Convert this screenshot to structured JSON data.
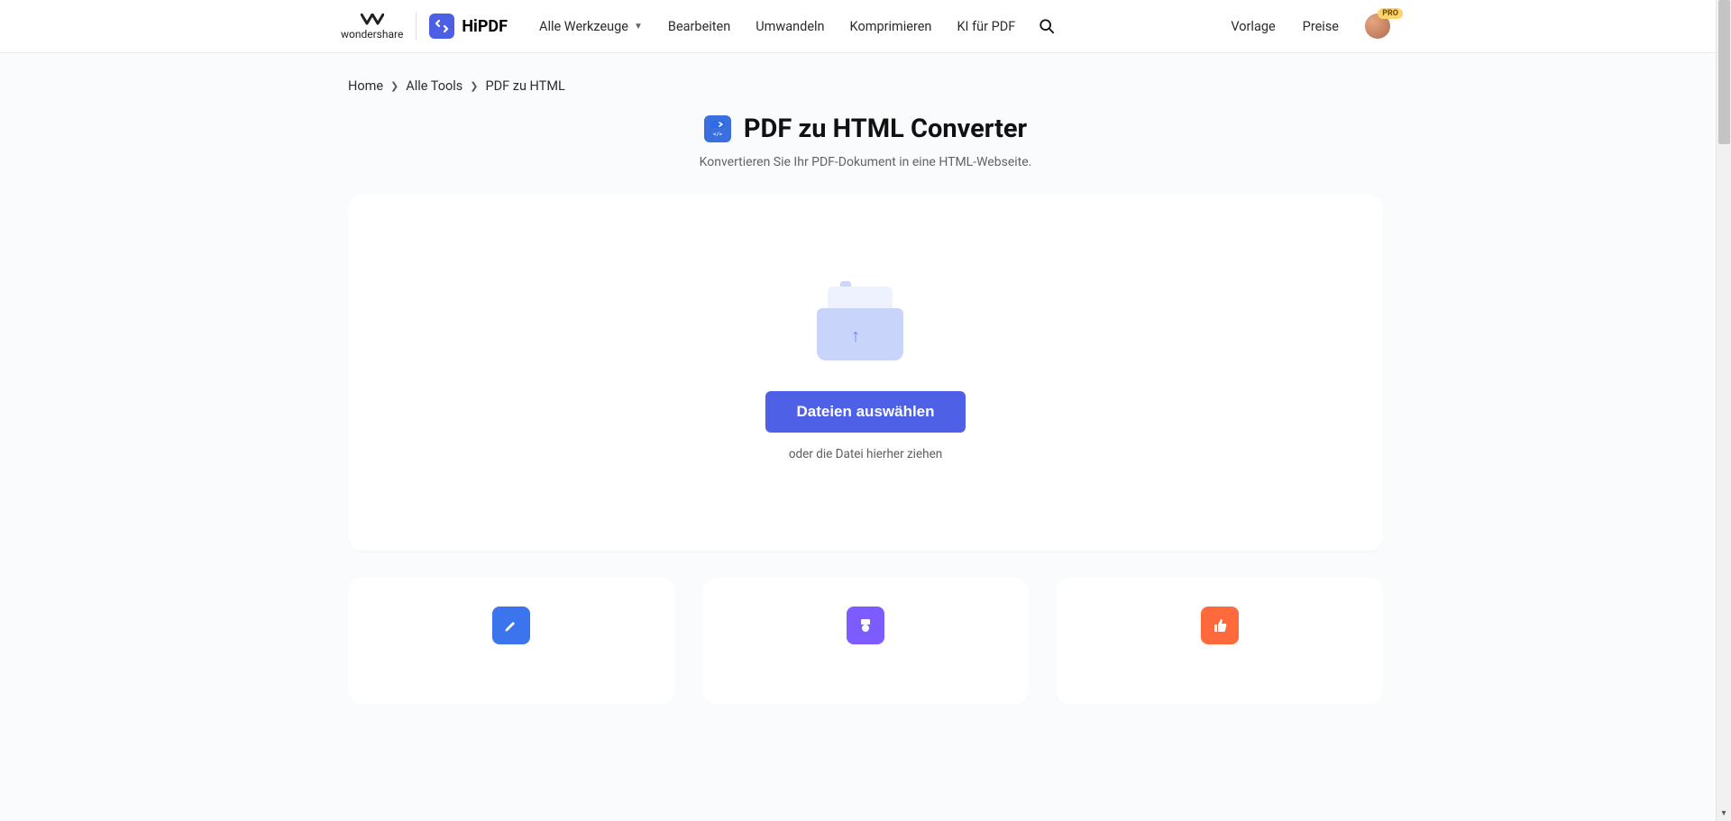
{
  "brand": {
    "wondershare": "wondershare",
    "hipdf": "HiPDF"
  },
  "nav": {
    "all_tools": "Alle Werkzeuge",
    "edit": "Bearbeiten",
    "convert": "Umwandeln",
    "compress": "Komprimieren",
    "ai_pdf": "KI für PDF"
  },
  "header_right": {
    "template": "Vorlage",
    "pricing": "Preise",
    "pro_badge": "PRO"
  },
  "breadcrumb": {
    "home": "Home",
    "all_tools": "Alle Tools",
    "current": "PDF zu HTML"
  },
  "page": {
    "title": "PDF zu HTML Converter",
    "subtitle": "Konvertieren Sie Ihr PDF-Dokument in eine HTML-Webseite."
  },
  "upload": {
    "choose_button": "Dateien auswählen",
    "drop_hint": "oder die Datei hierher ziehen"
  },
  "icons": {
    "title_icon_label": "</>"
  }
}
